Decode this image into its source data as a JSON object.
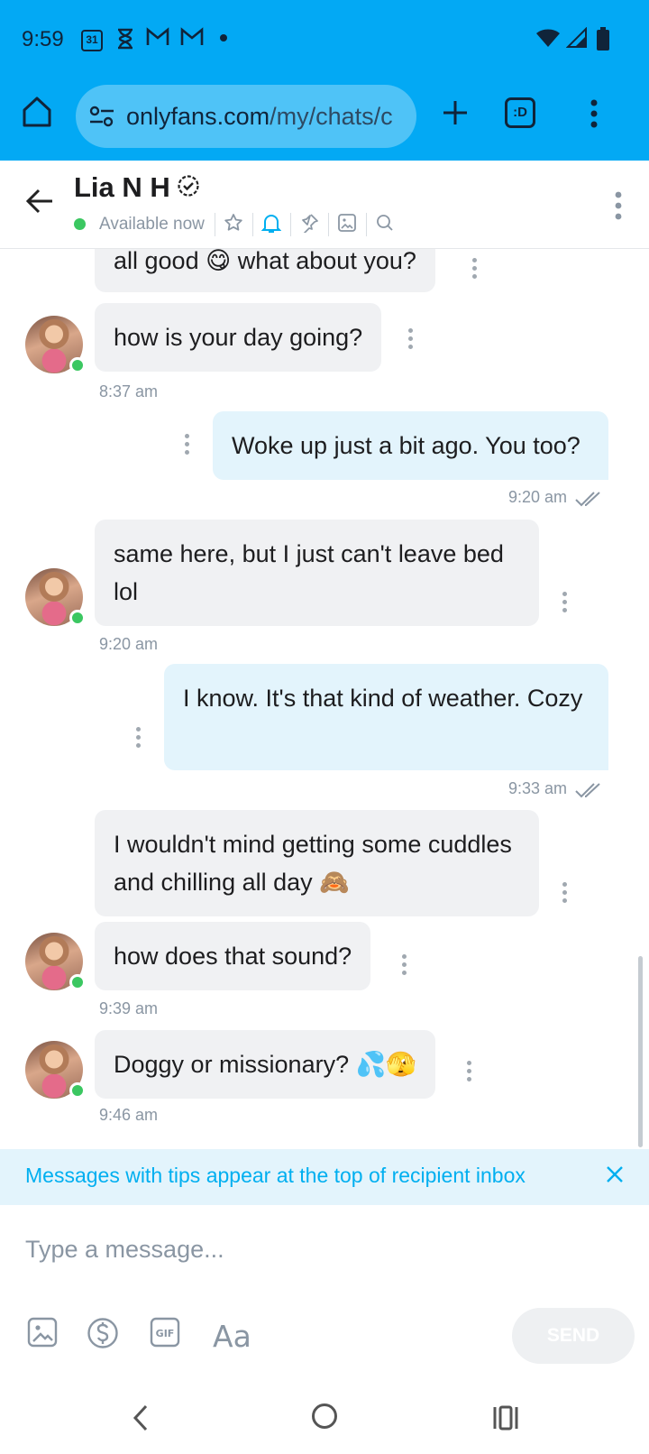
{
  "status_bar": {
    "time": "9:59",
    "calendar_day": "31"
  },
  "browser": {
    "url_host": "onlyfans.com",
    "url_path": "/my/chats/c",
    "tab_label": ":D"
  },
  "chat_header": {
    "name": "Lia N H",
    "status": "Available now"
  },
  "messages": [
    {
      "text": "all good 😋 what about you?",
      "direction": "in"
    },
    {
      "text": "how is your day going?",
      "direction": "in",
      "time": "8:37 am"
    },
    {
      "text": "Woke up just a bit ago. You too?",
      "direction": "out",
      "time": "9:20 am"
    },
    {
      "text": "same here, but I just can't leave bed lol",
      "direction": "in",
      "time": "9:20 am"
    },
    {
      "text": "I know. It's that kind of weather. Cozy",
      "direction": "out",
      "time": "9:33 am"
    },
    {
      "text": "I wouldn't mind getting some cuddles and chilling all day 🙈",
      "direction": "in"
    },
    {
      "text": "how does that sound?",
      "direction": "in",
      "time": "9:39 am"
    },
    {
      "text": "Doggy or missionary? 💦🫣",
      "direction": "in",
      "time": "9:46 am"
    }
  ],
  "tip_banner": {
    "text": "Messages with tips appear at the top of recipient inbox"
  },
  "composer": {
    "placeholder": "Type a message...",
    "font_label": "Aa",
    "send_label": "SEND"
  },
  "colors": {
    "brand": "#00aff0",
    "browser_bar": "#03a9f4",
    "incoming_bubble": "#f0f1f3",
    "outgoing_bubble": "#e3f4fc",
    "online": "#3bc761"
  }
}
